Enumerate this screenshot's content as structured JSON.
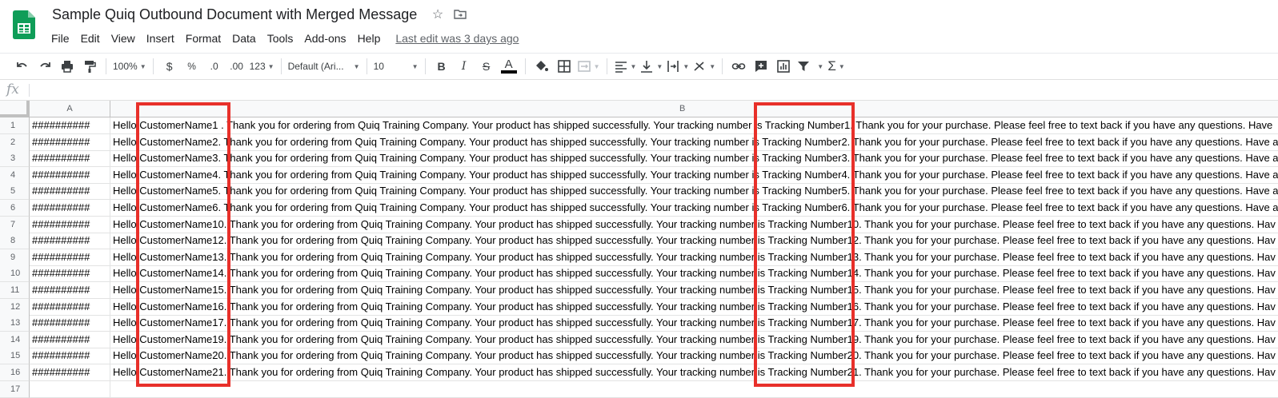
{
  "header": {
    "title": "Sample Quiq Outbound Document with Merged Message",
    "menu": [
      "File",
      "Edit",
      "View",
      "Insert",
      "Format",
      "Data",
      "Tools",
      "Add-ons",
      "Help"
    ],
    "last_edit": "Last edit was 3 days ago"
  },
  "toolbar": {
    "zoom": "100%",
    "currency": "$",
    "percent": "%",
    "decrease_decimal": ".0",
    "increase_decimal": ".00",
    "more_formats": "123",
    "font": "Default (Ari...",
    "font_size": "10",
    "bold": "B",
    "italic": "I",
    "strikethrough": "S",
    "text_color": "A",
    "functions": "Σ"
  },
  "formula_bar": {
    "fx": "fx"
  },
  "grid": {
    "columns": [
      "A",
      "B"
    ],
    "rows": [
      {
        "num": "1",
        "a": "##########",
        "b": "Hello CustomerName1 . Thank you for ordering from Quiq Training Company. Your product has shipped successfully. Your tracking number is Tracking Number1. Thank you for your purchase. Please feel free to text back if you have any questions. Have"
      },
      {
        "num": "2",
        "a": "##########",
        "b": "Hello CustomerName2. Thank you for ordering from Quiq Training Company. Your product has shipped successfully. Your tracking number is Tracking Number2. Thank you for your purchase. Please feel free to text back if you have any questions. Have a"
      },
      {
        "num": "3",
        "a": "##########",
        "b": "Hello CustomerName3. Thank you for ordering from Quiq Training Company. Your product has shipped successfully. Your tracking number is Tracking Number3. Thank you for your purchase. Please feel free to text back if you have any questions. Have a"
      },
      {
        "num": "4",
        "a": "##########",
        "b": "Hello CustomerName4. Thank you for ordering from Quiq Training Company. Your product has shipped successfully. Your tracking number is Tracking Number4. Thank you for your purchase. Please feel free to text back if you have any questions. Have a"
      },
      {
        "num": "5",
        "a": "##########",
        "b": "Hello CustomerName5. Thank you for ordering from Quiq Training Company. Your product has shipped successfully. Your tracking number is Tracking Number5. Thank you for your purchase. Please feel free to text back if you have any questions. Have a"
      },
      {
        "num": "6",
        "a": "##########",
        "b": "Hello CustomerName6. Thank you for ordering from Quiq Training Company. Your product has shipped successfully. Your tracking number is Tracking Number6. Thank you for your purchase. Please feel free to text back if you have any questions. Have a"
      },
      {
        "num": "7",
        "a": "##########",
        "b": "Hello CustomerName10. Thank you for ordering from Quiq Training Company. Your product has shipped successfully. Your tracking number is Tracking Number10. Thank you for your purchase. Please feel free to text back if you have any questions. Hav"
      },
      {
        "num": "8",
        "a": "##########",
        "b": "Hello CustomerName12. Thank you for ordering from Quiq Training Company. Your product has shipped successfully. Your tracking number is Tracking Number12. Thank you for your purchase. Please feel free to text back if you have any questions. Hav"
      },
      {
        "num": "9",
        "a": "##########",
        "b": "Hello CustomerName13. Thank you for ordering from Quiq Training Company. Your product has shipped successfully. Your tracking number is Tracking Number13. Thank you for your purchase. Please feel free to text back if you have any questions. Hav"
      },
      {
        "num": "10",
        "a": "##########",
        "b": "Hello CustomerName14. Thank you for ordering from Quiq Training Company. Your product has shipped successfully. Your tracking number is Tracking Number14. Thank you for your purchase. Please feel free to text back if you have any questions. Hav"
      },
      {
        "num": "11",
        "a": "##########",
        "b": "Hello CustomerName15. Thank you for ordering from Quiq Training Company. Your product has shipped successfully. Your tracking number is Tracking Number15. Thank you for your purchase. Please feel free to text back if you have any questions. Hav"
      },
      {
        "num": "12",
        "a": "##########",
        "b": "Hello CustomerName16. Thank you for ordering from Quiq Training Company. Your product has shipped successfully. Your tracking number is Tracking Number16. Thank you for your purchase. Please feel free to text back if you have any questions. Hav"
      },
      {
        "num": "13",
        "a": "##########",
        "b": "Hello CustomerName17. Thank you for ordering from Quiq Training Company. Your product has shipped successfully. Your tracking number is Tracking Number17. Thank you for your purchase. Please feel free to text back if you have any questions. Hav"
      },
      {
        "num": "14",
        "a": "##########",
        "b": "Hello CustomerName19. Thank you for ordering from Quiq Training Company. Your product has shipped successfully. Your tracking number is Tracking Number19. Thank you for your purchase. Please feel free to text back if you have any questions. Hav"
      },
      {
        "num": "15",
        "a": "##########",
        "b": "Hello CustomerName20. Thank you for ordering from Quiq Training Company. Your product has shipped successfully. Your tracking number is Tracking Number20. Thank you for your purchase. Please feel free to text back if you have any questions. Hav"
      },
      {
        "num": "16",
        "a": "##########",
        "b": "Hello CustomerName21. Thank you for ordering from Quiq Training Company. Your product has shipped successfully. Your tracking number is Tracking Number21. Thank you for your purchase. Please feel free to text back if you have any questions. Hav"
      },
      {
        "num": "17",
        "a": "",
        "b": ""
      }
    ]
  },
  "colors": {
    "highlight": "#e8302a",
    "sheets_green": "#0f9d58"
  }
}
